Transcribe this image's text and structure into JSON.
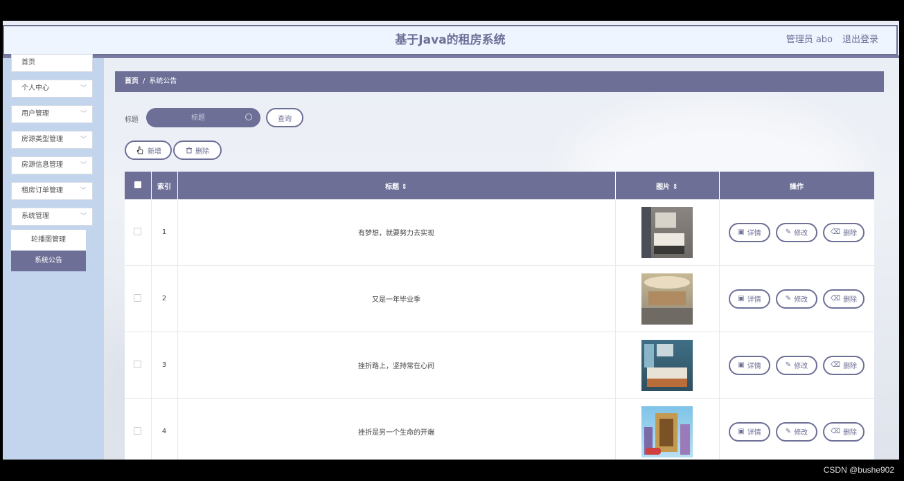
{
  "header": {
    "title": "基于Java的租房系统",
    "user": "管理员 abo",
    "logout": "退出登录"
  },
  "sidebar": {
    "items": [
      {
        "label": "首页"
      },
      {
        "label": "个人中心"
      },
      {
        "label": "用户管理"
      },
      {
        "label": "房源类型管理"
      },
      {
        "label": "房源信息管理"
      },
      {
        "label": "租房订单管理"
      },
      {
        "label": "系统管理"
      }
    ],
    "sub_items": [
      {
        "label": "轮播图管理",
        "active": false
      },
      {
        "label": "系统公告",
        "active": true
      }
    ]
  },
  "breadcrumb": {
    "home": "首页",
    "separator": "/",
    "current": "系统公告"
  },
  "search": {
    "label": "标题",
    "placeholder": "标题",
    "query_button": "查询"
  },
  "actions": {
    "add": "新增",
    "delete": "删除"
  },
  "table": {
    "headers": {
      "index": "索引",
      "title": "标题 ⇕",
      "image": "图片 ⇕",
      "operations": "操作"
    },
    "rows": [
      {
        "index": "1",
        "title": "有梦想，就要努力去实现"
      },
      {
        "index": "2",
        "title": "又是一年毕业季"
      },
      {
        "index": "3",
        "title": "挫折路上，坚持常在心间"
      },
      {
        "index": "4",
        "title": "挫折是另一个生命的开端"
      }
    ],
    "row_buttons": {
      "detail": "详情",
      "edit": "修改",
      "delete": "删除"
    }
  },
  "watermark": "CSDN @bushe902",
  "colors": {
    "accent": "#6d6f96",
    "sidebar_bg": "#c2d5ec",
    "header_bg": "#eef5ff"
  }
}
